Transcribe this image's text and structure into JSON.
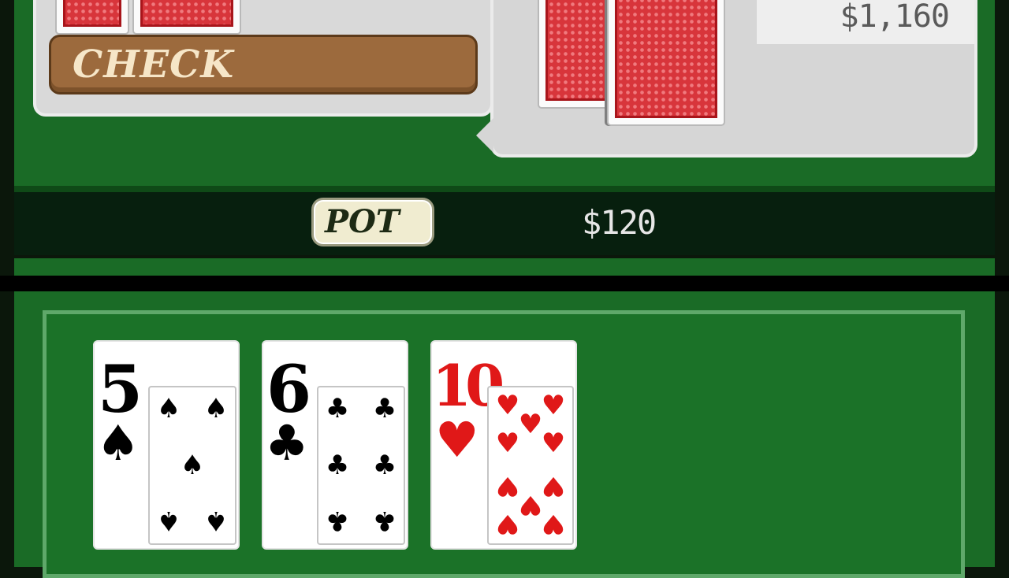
{
  "opponent_panel": {
    "chips": "$1,160",
    "cards_face_down": 2
  },
  "player_panel": {
    "action": "CHECK",
    "cards_face_down": 2
  },
  "pot": {
    "label": "POT",
    "amount": "$120"
  },
  "board": {
    "cards": [
      {
        "rank": "5",
        "suit": "spade",
        "suit_glyph": "♠",
        "color": "#000000"
      },
      {
        "rank": "6",
        "suit": "club",
        "suit_glyph": "♣",
        "color": "#000000"
      },
      {
        "rank": "10",
        "suit": "heart",
        "suit_glyph": "♥",
        "color": "#e01818"
      }
    ]
  },
  "colors": {
    "felt": "#1a6b26",
    "pot_bar": "#071f0e",
    "action_bar": "#9c6a3d",
    "card_back": "#d8353b"
  }
}
